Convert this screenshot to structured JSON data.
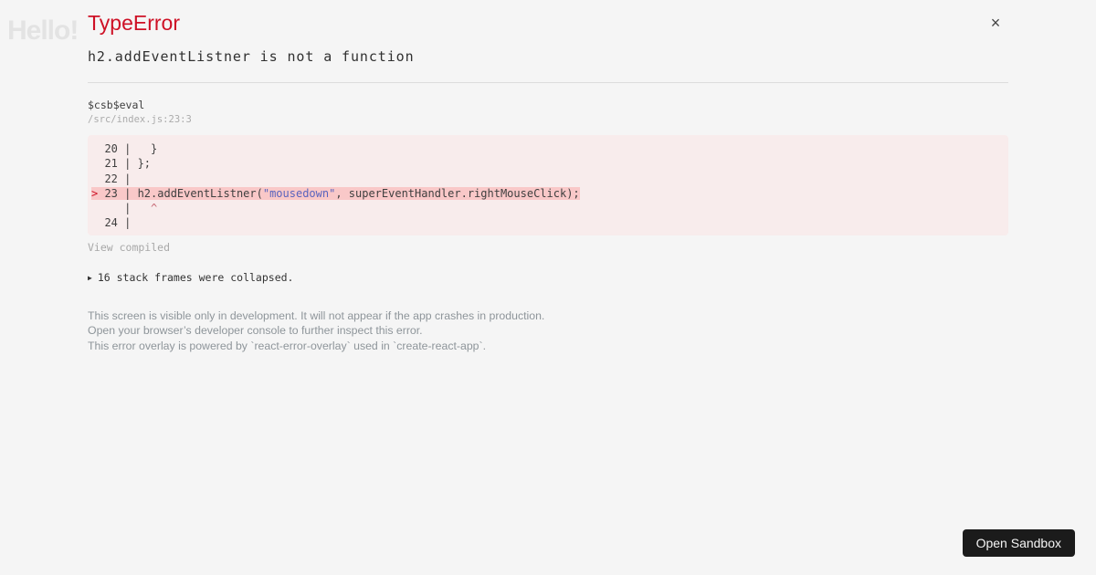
{
  "page_background": {
    "hello_text": "Hello!"
  },
  "overlay": {
    "title": "TypeError",
    "message": "h2.addEventListner is not a function",
    "close_icon_glyph": "×",
    "stack_frame": {
      "function_name": "$csb$eval",
      "location": "/src/index.js:23:3"
    },
    "code_frame": {
      "lines": [
        {
          "highlight": false,
          "segments": [
            {
              "t": "  20 |   }",
              "c": "code"
            }
          ]
        },
        {
          "highlight": false,
          "segments": [
            {
              "t": "  21 | };",
              "c": "code"
            }
          ]
        },
        {
          "highlight": false,
          "segments": [
            {
              "t": "  22 | ",
              "c": "code"
            }
          ]
        },
        {
          "highlight": true,
          "segments": [
            {
              "t": "> ",
              "c": "marker"
            },
            {
              "t": "23 | h2.addEventListner(",
              "c": "code"
            },
            {
              "t": "\"mousedown\"",
              "c": "string"
            },
            {
              "t": ", superEventHandler.rightMouseClick);",
              "c": "code"
            }
          ]
        },
        {
          "highlight": false,
          "segments": [
            {
              "t": "     |   ",
              "c": "code"
            },
            {
              "t": "^",
              "c": "caret"
            }
          ]
        },
        {
          "highlight": false,
          "segments": [
            {
              "t": "  24 | ",
              "c": "code"
            }
          ]
        }
      ]
    },
    "view_compiled_label": "View compiled",
    "collapsed_frames": {
      "icon": "▶",
      "label": "16 stack frames were collapsed."
    },
    "footer_lines": [
      "This screen is visible only in development. It will not appear if the app crashes in production.",
      "Open your browser’s developer console to further inspect this error.",
      "This error overlay is powered by `react-error-overlay` used in `create-react-app`."
    ]
  },
  "open_sandbox_button": {
    "label": "Open Sandbox"
  },
  "colors": {
    "page_bg": "#f5f5f5",
    "error_red": "#ce1126",
    "code_frame_bg": "#f8ecec",
    "highlight_row_bg": "#f9c8c8",
    "code_string_blue": "#5a64be",
    "caret_red": "#c76a75",
    "footer_grey": "#8e959a",
    "button_bg": "#1b1b1b"
  }
}
